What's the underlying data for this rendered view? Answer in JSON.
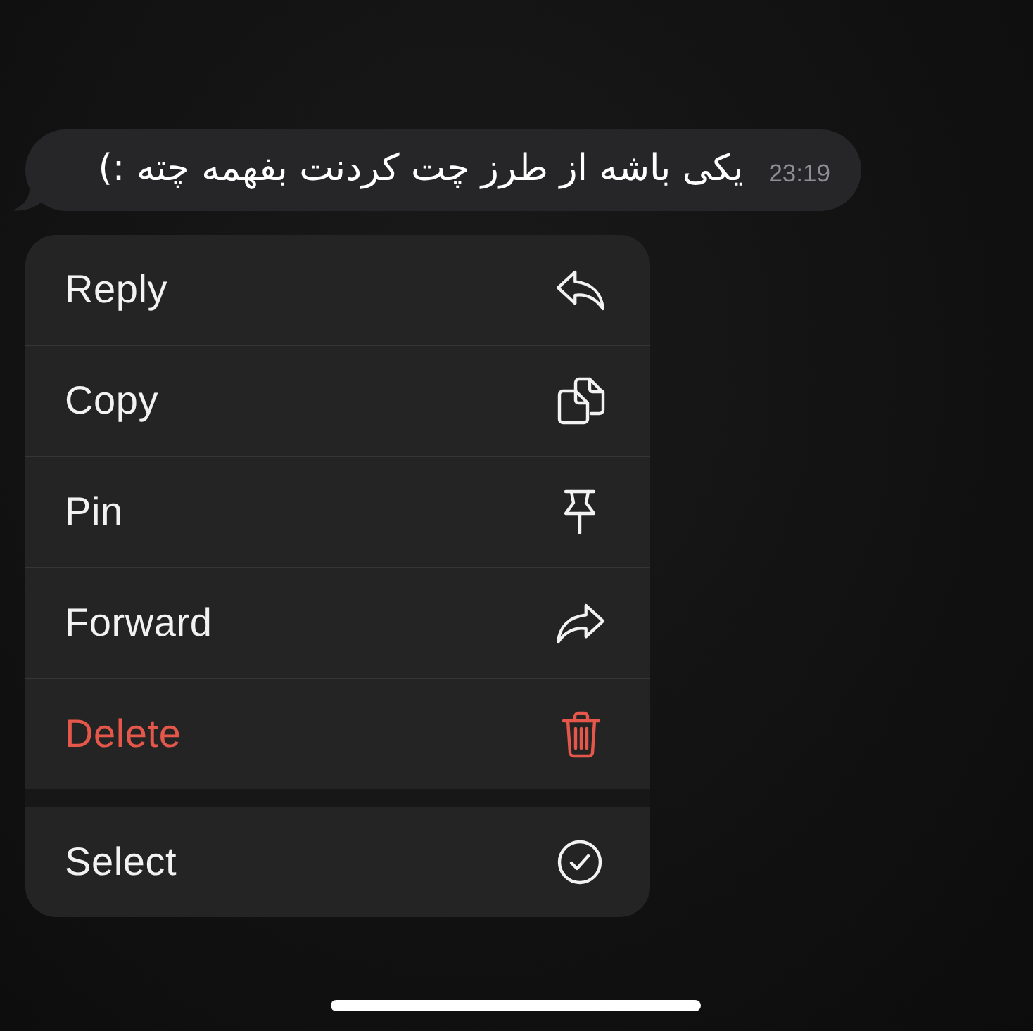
{
  "message": {
    "text": "یکی باشه از طرز چت کردنت بفهمه چته :)",
    "time": "23:19"
  },
  "menu": {
    "groups": [
      {
        "items": [
          {
            "label": "Reply",
            "kind": "reply"
          },
          {
            "label": "Copy",
            "kind": "copy"
          },
          {
            "label": "Pin",
            "kind": "pin"
          },
          {
            "label": "Forward",
            "kind": "forward"
          },
          {
            "label": "Delete",
            "kind": "delete"
          }
        ]
      },
      {
        "items": [
          {
            "label": "Select",
            "kind": "select"
          }
        ]
      }
    ]
  }
}
